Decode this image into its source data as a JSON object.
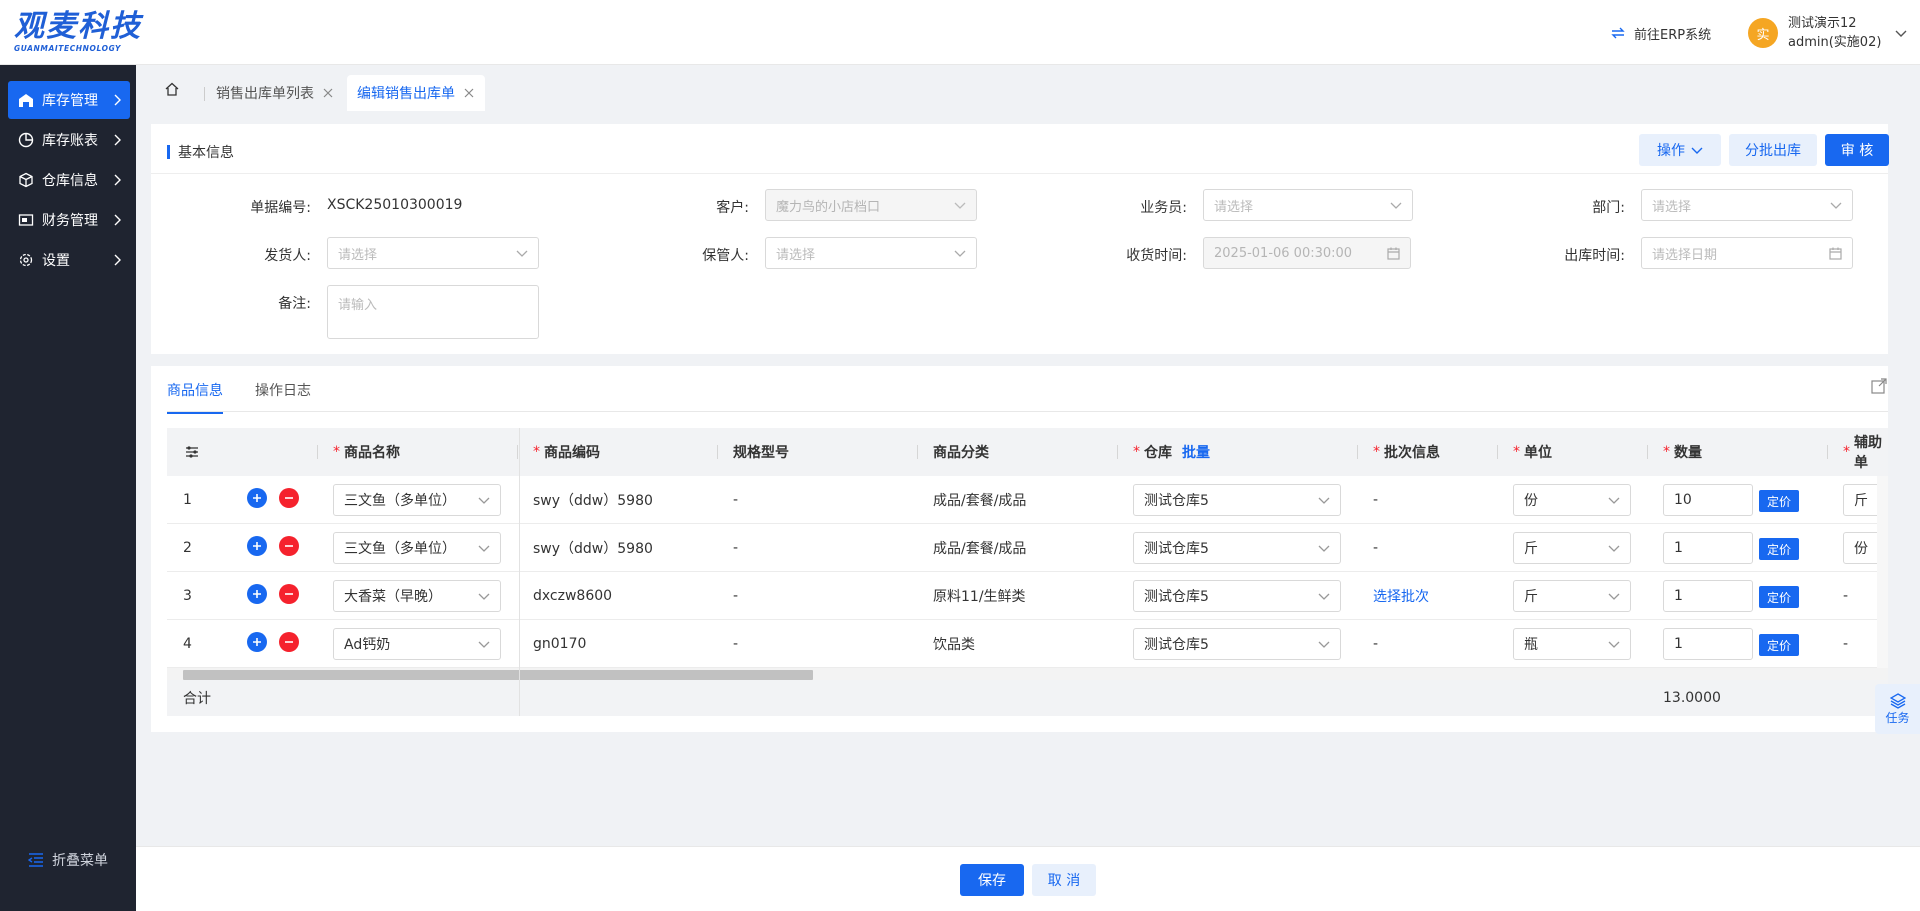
{
  "header": {
    "logo_text": "观麦科技",
    "logo_sub": "GUANMAITECHNOLOGY",
    "erp_link": "前往ERP系统",
    "avatar_char": "实",
    "user_name": "测试演示12",
    "user_account": "admin(实施02)"
  },
  "sidebar": {
    "items": [
      {
        "label": "库存管理",
        "icon": "warehouse-icon"
      },
      {
        "label": "库存账表",
        "icon": "chart-pie-icon"
      },
      {
        "label": "仓库信息",
        "icon": "cube-icon"
      },
      {
        "label": "财务管理",
        "icon": "wallet-icon"
      },
      {
        "label": "设置",
        "icon": "gear-icon"
      }
    ],
    "collapse_label": "折叠菜单"
  },
  "tabs": [
    {
      "label": "销售出库单列表"
    },
    {
      "label": "编辑销售出库单"
    }
  ],
  "basic": {
    "title": "基本信息",
    "op_label": "操作",
    "batch_label": "分批出库",
    "audit_label": "审 核",
    "fields": {
      "doc_no_label": "单据编号:",
      "doc_no_value": "XSCK25010300019",
      "customer_label": "客户:",
      "customer_value": "魔力鸟的小店档口",
      "salesman_label": "业务员:",
      "salesman_placeholder": "请选择",
      "dept_label": "部门:",
      "dept_placeholder": "请选择",
      "shipper_label": "发货人:",
      "shipper_placeholder": "请选择",
      "keeper_label": "保管人:",
      "keeper_placeholder": "请选择",
      "receive_time_label": "收货时间:",
      "receive_time_value": "2025-01-06 00:30:00",
      "out_time_label": "出库时间:",
      "out_time_placeholder": "请选择日期",
      "remark_label": "备注:",
      "remark_placeholder": "请输入"
    }
  },
  "product": {
    "tabs": [
      "商品信息",
      "操作日志"
    ],
    "columns": {
      "name": "商品名称",
      "code": "商品编码",
      "spec": "规格型号",
      "category": "商品分类",
      "warehouse": "仓库",
      "batch_set": "批量",
      "batch_info": "批次信息",
      "unit": "单位",
      "qty": "数量",
      "aux": "辅助单"
    },
    "rows": [
      {
        "no": "1",
        "name": "三文鱼（多单位）",
        "code": "swy（ddw）5980",
        "spec": "-",
        "category": "成品/套餐/成品",
        "warehouse": "测试仓库5",
        "batch": "-",
        "unit": "份",
        "qty": "10",
        "aux": "斤"
      },
      {
        "no": "2",
        "name": "三文鱼（多单位）",
        "code": "swy（ddw）5980",
        "spec": "-",
        "category": "成品/套餐/成品",
        "warehouse": "测试仓库5",
        "batch": "-",
        "unit": "斤",
        "qty": "1",
        "aux": "份"
      },
      {
        "no": "3",
        "name": "大香菜（早晚）",
        "code": "dxczw8600",
        "spec": "-",
        "category": "原料11/生鲜类",
        "warehouse": "测试仓库5",
        "batch": "选择批次",
        "unit": "斤",
        "qty": "1",
        "aux": "-"
      },
      {
        "no": "4",
        "name": "Ad钙奶",
        "code": "gn0170",
        "spec": "-",
        "category": "饮品类",
        "warehouse": "测试仓库5",
        "batch": "-",
        "unit": "瓶",
        "qty": "1",
        "aux": "-"
      }
    ],
    "price_btn": "定价",
    "total_label": "合计",
    "total_qty": "13.0000"
  },
  "task_label": "任务",
  "footer": {
    "save": "保存",
    "cancel": "取 消"
  }
}
